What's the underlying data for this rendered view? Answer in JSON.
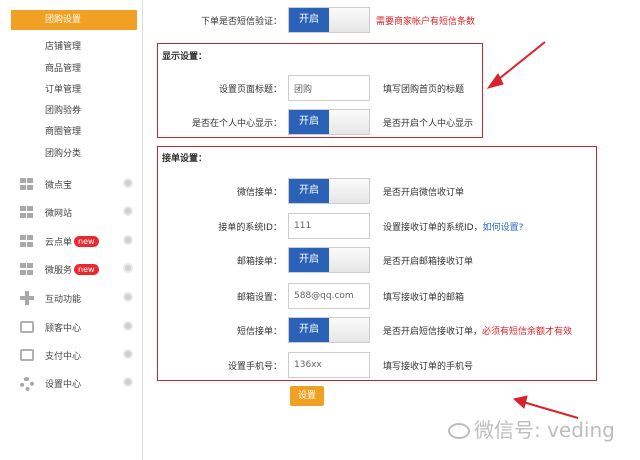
{
  "sidebar": {
    "active_sub": "团购设置",
    "sub_items": [
      "店铺管理",
      "商品管理",
      "订单管理",
      "团购验券",
      "商圈管理",
      "团购分类"
    ],
    "main_items": [
      {
        "label": "微点宝",
        "icon": "grid-icon",
        "badge": ""
      },
      {
        "label": "微网站",
        "icon": "grid-icon",
        "badge": ""
      },
      {
        "label": "云点单",
        "icon": "grid-icon",
        "badge": "new"
      },
      {
        "label": "微服务",
        "icon": "grid-icon",
        "badge": "new"
      },
      {
        "label": "互动功能",
        "icon": "plus-icon",
        "badge": ""
      },
      {
        "label": "顾客中心",
        "icon": "contact-icon",
        "badge": ""
      },
      {
        "label": "支付中心",
        "icon": "wallet-icon",
        "badge": ""
      },
      {
        "label": "设置中心",
        "icon": "gear-icon",
        "badge": ""
      }
    ]
  },
  "form": {
    "sms_verify": {
      "label": "下单是否短信验证：",
      "toggle": "开启",
      "hint": "需要商家帐户有短信条数"
    },
    "display": {
      "title": "显示设置：",
      "page_title": {
        "label": "设置页面标题：",
        "value": "团购",
        "hint": "填写团购首页的标题"
      },
      "personal_center": {
        "label": "是否在个人中心显示：",
        "toggle": "开启",
        "hint": "是否开启个人中心显示"
      }
    },
    "orders": {
      "title": "接单设置：",
      "wechat": {
        "label": "微信接单：",
        "toggle": "开启",
        "hint": "是否开启微信收订单"
      },
      "system_id": {
        "label": "接单的系统ID：",
        "value": "111",
        "hint": "设置接收订单的系统ID，",
        "link": "如何设置?"
      },
      "email_order": {
        "label": "邮箱接单：",
        "toggle": "开启",
        "hint": "是否开启邮箱接收订单"
      },
      "email_setting": {
        "label": "邮箱设置：",
        "value": "588@qq.com",
        "hint": "填写接收订单的邮箱"
      },
      "sms_order": {
        "label": "短信接单：",
        "toggle": "开启",
        "hint": "是否开启短信接收订单，",
        "warn": "必须有短信余额才有效"
      },
      "phone": {
        "label": "设置手机号：",
        "value": "136xx",
        "hint": "填写接收订单的手机号"
      }
    },
    "submit": "设置"
  },
  "watermark": "微信号: veding",
  "colors": {
    "accent": "#f0a022",
    "toggle_on": "#2a62b8",
    "highlight": "#c8282c",
    "badge": "#e8292f"
  }
}
